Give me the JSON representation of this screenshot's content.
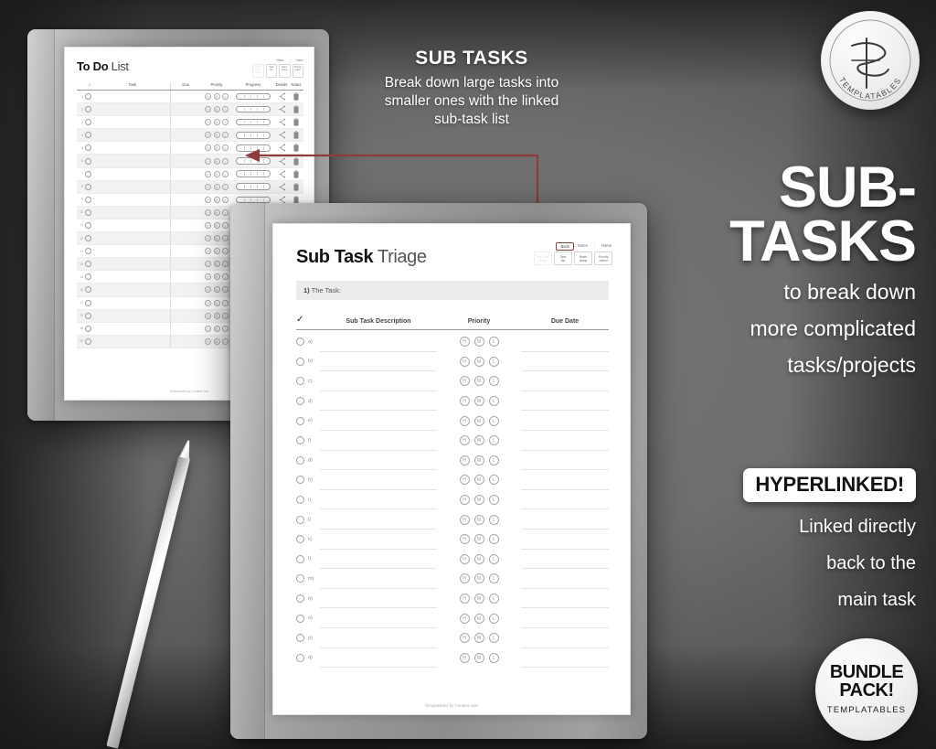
{
  "background": {
    "base_color": "#6e6e6e",
    "edge_color": "#262626"
  },
  "callout": {
    "heading": "SUB TASKS",
    "body_line1": "Break down large tasks into",
    "body_line2": "smaller ones with the linked",
    "body_line3": "sub-task list"
  },
  "hero": {
    "line1": "SUB-",
    "line2": "TASKS",
    "sub_line1": "to break down",
    "sub_line2": "more complicated",
    "sub_line3": "tasks/projects"
  },
  "hyperlinked": {
    "badge": "HYPERLINKED!",
    "sub_line1": "Linked directly",
    "sub_line2": "back to the",
    "sub_line3": "main task"
  },
  "logo_badge": {
    "monogram": "TS",
    "curved_text": "TEMPLATABLES"
  },
  "bundle_badge": {
    "line1": "BUNDLE",
    "line2": "PACK!",
    "brand": "TEMPLATABLES"
  },
  "connector": {
    "color": "#8e3b3b",
    "from": "back-button",
    "to": "todo-row-5"
  },
  "todo_page": {
    "title_bold": "To Do",
    "title_light": "List",
    "nav": {
      "top": [
        "Notes",
        "Home"
      ],
      "buttons": [
        {
          "label_line1": "Sub Task",
          "label_line2": "Triage",
          "dim": true
        },
        {
          "label_line1": "Task",
          "label_line2": "list",
          "dim": false
        },
        {
          "label_line1": "Brain",
          "label_line2": "dump",
          "dim": false
        },
        {
          "label_line1": "Priority",
          "label_line2": "matrix",
          "dim": false
        }
      ]
    },
    "columns": [
      "✓",
      "Task",
      "Due",
      "Priority",
      "Progress",
      "Details",
      "Notes"
    ],
    "priority_options": [
      "H",
      "M",
      "L"
    ],
    "row_numbers": [
      1,
      2,
      3,
      4,
      5,
      6,
      7,
      8,
      9,
      10,
      11,
      12,
      13,
      14,
      15,
      16,
      17,
      18,
      19,
      20
    ],
    "footer": "Templatables by Creative Jam"
  },
  "subtask_page": {
    "title_bold": "Sub Task",
    "title_light": "Triage",
    "nav": {
      "top": [
        "Back",
        "Notes",
        "Home"
      ],
      "highlighted_top": "Back",
      "buttons": [
        {
          "label_line1": "Sub Task",
          "label_line2": "Triage",
          "dim": true
        },
        {
          "label_line1": "Task",
          "label_line2": "list",
          "dim": false
        },
        {
          "label_line1": "Brain",
          "label_line2": "dump",
          "dim": false
        },
        {
          "label_line1": "Priority",
          "label_line2": "matrix",
          "dim": false
        }
      ]
    },
    "task_field": {
      "number": "1)",
      "label": "The Task:",
      "value": ""
    },
    "columns": [
      "✓",
      "Sub Task Description",
      "Priority",
      "Due Date"
    ],
    "priority_options": [
      "H",
      "M",
      "L"
    ],
    "row_labels": [
      "a)",
      "b)",
      "c)",
      "d)",
      "e)",
      "f)",
      "g)",
      "h)",
      "i)",
      "j)",
      "k)",
      "l)",
      "m)",
      "n)",
      "o)",
      "p)",
      "q)"
    ],
    "footer": "Templatables by Creative Jam"
  }
}
